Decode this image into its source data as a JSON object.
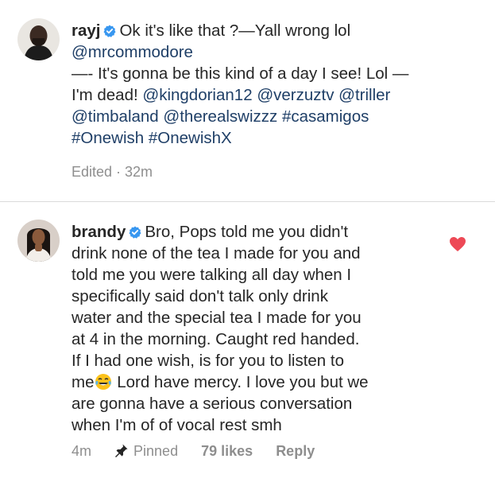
{
  "comment1": {
    "username": "rayj",
    "lines": [
      {
        "text": "Ok  it's like that ?—Yall wrong lol"
      },
      {
        "segments": [
          {
            "t": "@mrcommodore",
            "k": "mention"
          }
        ]
      },
      {
        "segments": [
          {
            "t": "—- It's gonna be this kind of a day I see! Lol —",
            "k": "text"
          }
        ]
      },
      {
        "segments": [
          {
            "t": "I'm dead! ",
            "k": "text"
          },
          {
            "t": "@kingdorian12",
            "k": "mention"
          },
          {
            "t": " ",
            "k": "text"
          },
          {
            "t": "@verzuztv",
            "k": "mention"
          },
          {
            "t": " ",
            "k": "text"
          },
          {
            "t": "@triller",
            "k": "mention"
          }
        ]
      },
      {
        "segments": [
          {
            "t": "@timbaland",
            "k": "mention"
          },
          {
            "t": " ",
            "k": "text"
          },
          {
            "t": "@therealswizzz",
            "k": "mention"
          },
          {
            "t": " ",
            "k": "text"
          },
          {
            "t": "#casamigos",
            "k": "tag"
          }
        ]
      },
      {
        "segments": [
          {
            "t": "#Onewish",
            "k": "tag"
          },
          {
            "t": " ",
            "k": "text"
          },
          {
            "t": "#OnewishX",
            "k": "tag"
          }
        ]
      }
    ],
    "meta": {
      "edited": "Edited · 32m"
    }
  },
  "comment2": {
    "username": "brandy",
    "lines": [
      "Bro, Pops told me you didn't",
      "drink none of the tea I made for you and",
      "told me you were talking all day when I",
      "specifically said don't talk only drink",
      "water and the special tea I made for you",
      "at 4 in the morning. Caught red handed.",
      "If I had one wish, is for you to listen to",
      "me",
      "Lord have mercy. I love you but we",
      "are gonna have a serious conversation",
      "when I'm of of vocal rest smh"
    ],
    "meta": {
      "time": "4m",
      "pinned": "Pinned",
      "likes": "79 likes",
      "reply": "Reply"
    },
    "liked": true
  },
  "colors": {
    "mention": "#1f3f67",
    "verified": "#3897f0",
    "heart": "#ed4956",
    "meta": "#8e8e8e"
  },
  "icons": [
    "verified-badge-icon",
    "pin-icon",
    "heart-icon",
    "laughing-tears-emoji-icon"
  ]
}
